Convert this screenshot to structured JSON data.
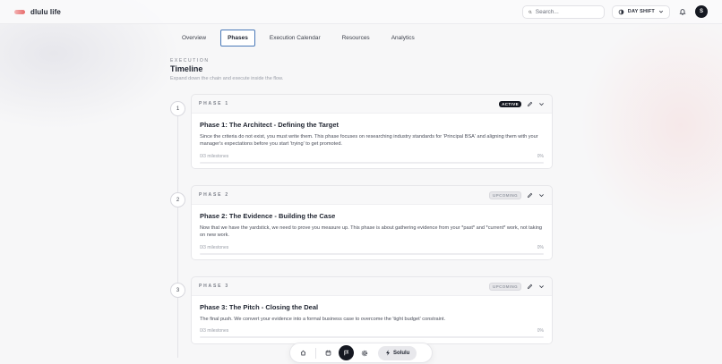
{
  "app": {
    "name": "dlulu life"
  },
  "header": {
    "search_placeholder": "Search...",
    "shift_label": "DAY SHIFT",
    "avatar_initial": "S"
  },
  "tabs": [
    {
      "label": "Overview",
      "active": false
    },
    {
      "label": "Phases",
      "active": true
    },
    {
      "label": "Execution Calendar",
      "active": false
    },
    {
      "label": "Resources",
      "active": false
    },
    {
      "label": "Analytics",
      "active": false
    }
  ],
  "section": {
    "kicker": "EXECUTION",
    "title": "Timeline",
    "subtitle": "Expand down the chain and execute inside the flow."
  },
  "phases": [
    {
      "number": "1",
      "label": "PHASE 1",
      "status": "ACTIVE",
      "title": "Phase 1: The Architect - Defining the Target",
      "description": "Since the criteria do not exist, you must write them. This phase focuses on researching industry standards for 'Principal BSA' and aligning them with your manager's expectations before you start 'trying' to get promoted.",
      "milestones": "0/3 milestones",
      "percent_label": "0%",
      "progress": 0
    },
    {
      "number": "2",
      "label": "PHASE 2",
      "status": "UPCOMING",
      "title": "Phase 2: The Evidence - Building the Case",
      "description": "Now that we have the yardstick, we need to prove you measure up. This phase is about gathering evidence from your *past* and *current* work, not taking on new work.",
      "milestones": "0/3 milestones",
      "percent_label": "0%",
      "progress": 0
    },
    {
      "number": "3",
      "label": "PHASE 3",
      "status": "UPCOMING",
      "title": "Phase 3: The Pitch - Closing the Deal",
      "description": "The final push. We convert your evidence into a formal business case to overcome the 'tight budget' constraint.",
      "milestones": "0/3 milestones",
      "percent_label": "0%",
      "progress": 0
    }
  ],
  "dock": {
    "items": [
      "home-icon",
      "calendar-icon",
      "flag-icon",
      "gear-icon"
    ],
    "active_item": "flag-icon",
    "cta_label": "Solulu"
  }
}
